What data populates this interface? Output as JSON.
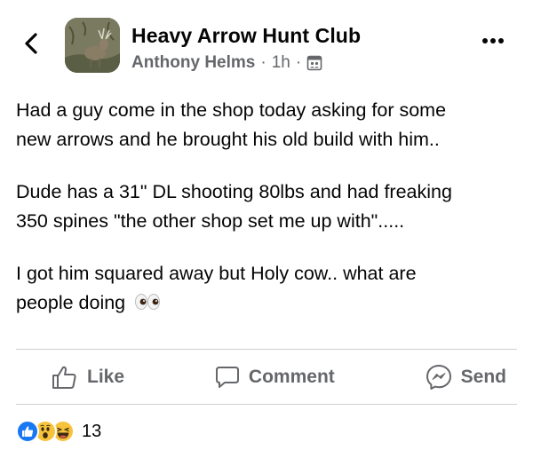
{
  "header": {
    "group_name": "Heavy Arrow Hunt Club",
    "author": "Anthony Helms",
    "separator": "·",
    "time": "1h",
    "back_icon": "chevron-left-icon",
    "more_icon": "more-horizontal-icon",
    "audience_icon": "group-audience-icon"
  },
  "post": {
    "paragraphs": [
      [
        "Had a guy come in the shop today asking for some",
        "new arrows and he brought his old build with him.."
      ],
      [
        "Dude has a 31\" DL shooting 80lbs and had freaking",
        "350 spines \"the other shop set me up with\"....."
      ],
      [
        "I got him squared away but Holy cow.. what are",
        "people doing"
      ]
    ],
    "trailing_emoji": "eyes-emoji"
  },
  "actions": {
    "like_label": "Like",
    "comment_label": "Comment",
    "send_label": "Send"
  },
  "reactions": {
    "types": [
      "like",
      "wow",
      "haha"
    ],
    "count": "13"
  },
  "colors": {
    "like_blue": "#1877f2",
    "reaction_yellow": "#f7c33b",
    "secondary_text": "#65676b"
  }
}
